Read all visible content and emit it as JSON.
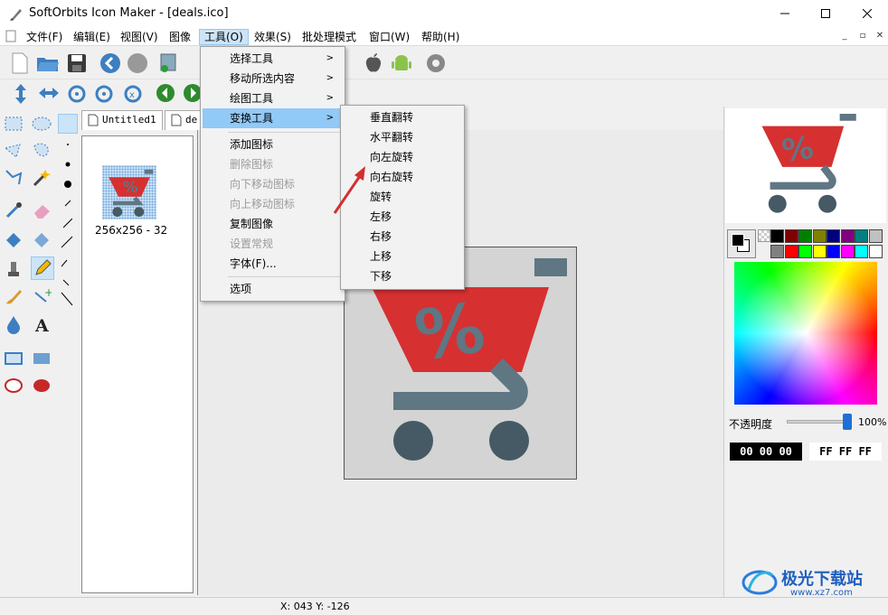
{
  "window": {
    "title": "SoftOrbits Icon Maker - [deals.ico]",
    "controls": [
      "minimize",
      "maximize",
      "close"
    ]
  },
  "menubar": {
    "items": [
      "文件(F)",
      "编辑(E)",
      "视图(V)",
      "图像",
      "工具(O)",
      "效果(S)",
      "批处理模式",
      "窗口(W)",
      "帮助(H)"
    ],
    "active_index": 4
  },
  "tools_menu": {
    "items": [
      {
        "label": "选择工具",
        "submenu": true,
        "disabled": false
      },
      {
        "label": "移动所选内容",
        "submenu": true,
        "disabled": false
      },
      {
        "label": "绘图工具",
        "submenu": true,
        "disabled": false
      },
      {
        "label": "变换工具",
        "submenu": true,
        "disabled": false,
        "highlighted": true
      },
      {
        "label": "添加图标",
        "submenu": false,
        "disabled": false
      },
      {
        "label": "删除图标",
        "submenu": false,
        "disabled": true
      },
      {
        "label": "向下移动图标",
        "submenu": false,
        "disabled": true
      },
      {
        "label": "向上移动图标",
        "submenu": false,
        "disabled": true
      },
      {
        "label": "复制图像",
        "submenu": false,
        "disabled": false
      },
      {
        "label": "设置常规",
        "submenu": false,
        "disabled": true
      },
      {
        "label": "字体(F)...",
        "submenu": false,
        "disabled": false
      },
      {
        "label": "选项",
        "submenu": false,
        "disabled": false
      }
    ]
  },
  "transform_submenu": {
    "items": [
      "垂直翻转",
      "水平翻转",
      "向左旋转",
      "向右旋转",
      "旋转",
      "左移",
      "右移",
      "上移",
      "下移"
    ]
  },
  "tabs": {
    "items": [
      "Untitled1",
      "de"
    ]
  },
  "icon_list": {
    "items": [
      {
        "label": "256x256 - 32"
      }
    ]
  },
  "canvas": {
    "icon_text": "%"
  },
  "right_panel": {
    "preview_text": "%",
    "palette_row1": [
      "#000000",
      "#800000",
      "#008000",
      "#808000",
      "#000080",
      "#800080",
      "#008080",
      "#c0c0c0"
    ],
    "palette_row2": [
      "#808080",
      "#ff0000",
      "#00ff00",
      "#ffff00",
      "#0000ff",
      "#ff00ff",
      "#00ffff",
      "#ffffff"
    ],
    "opacity_label": "不透明度",
    "opacity_value": "100%",
    "opacity_level": 1.0,
    "color_fg": "00 00 00",
    "color_bg": "FF FF FF"
  },
  "statusbar": {
    "coords": "X: 043 Y: -126"
  },
  "watermark": {
    "text": "极光下载站",
    "url": "www.xz7.com"
  },
  "colors": {
    "cart_red": "#d63031",
    "cart_gray": "#5f7683",
    "wheel": "#455a64",
    "menu_highlight": "#91c9f7"
  }
}
